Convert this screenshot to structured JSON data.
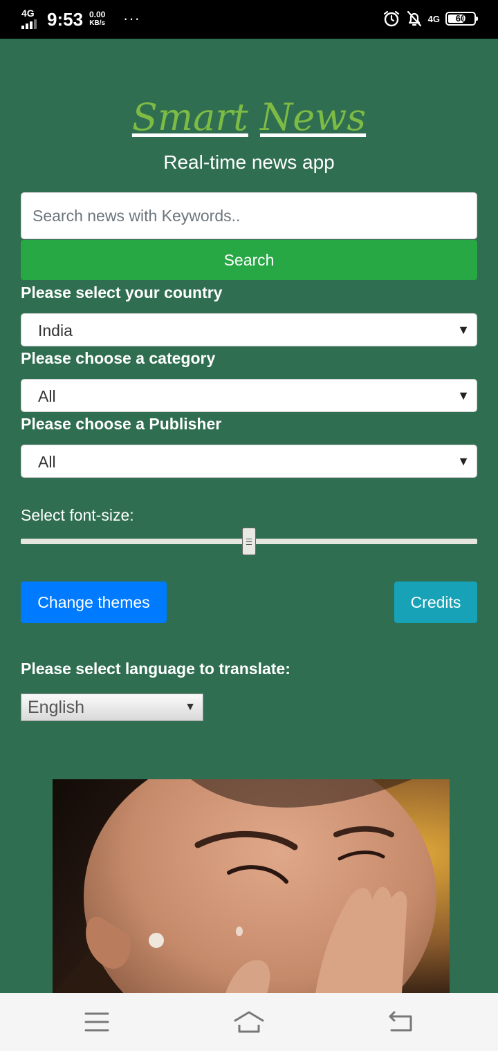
{
  "status_bar": {
    "network": "4G",
    "time": "9:53",
    "speed_value": "0.00",
    "speed_unit": "KB/s",
    "network_right": "4G",
    "battery": "60",
    "icons": [
      "signal-icon",
      "more-dots-icon",
      "alarm-icon",
      "notifications-off-icon",
      "battery-icon"
    ]
  },
  "header": {
    "brand_word1": "Smart",
    "brand_word2": "News",
    "tagline": "Real-time news app"
  },
  "search": {
    "placeholder": "Search news with Keywords..",
    "button_label": "Search"
  },
  "filters": {
    "country_label": "Please select your country",
    "country_value": "India",
    "category_label": "Please choose a category",
    "category_value": "All",
    "publisher_label": "Please choose a Publisher",
    "publisher_value": "All"
  },
  "font_size": {
    "label": "Select font-size:",
    "value_fraction": 0.5
  },
  "actions": {
    "change_themes": "Change themes",
    "credits": "Credits"
  },
  "translate": {
    "label": "Please select language to translate:",
    "value": "English"
  },
  "colors": {
    "background": "#2f6e50",
    "brand": "#7dbb45",
    "search_button": "#28a745",
    "themes_button": "#007bff",
    "credits_button": "#17a2b8"
  },
  "nav_bar": {
    "icons": [
      "menu-icon",
      "home-icon",
      "back-icon"
    ]
  }
}
